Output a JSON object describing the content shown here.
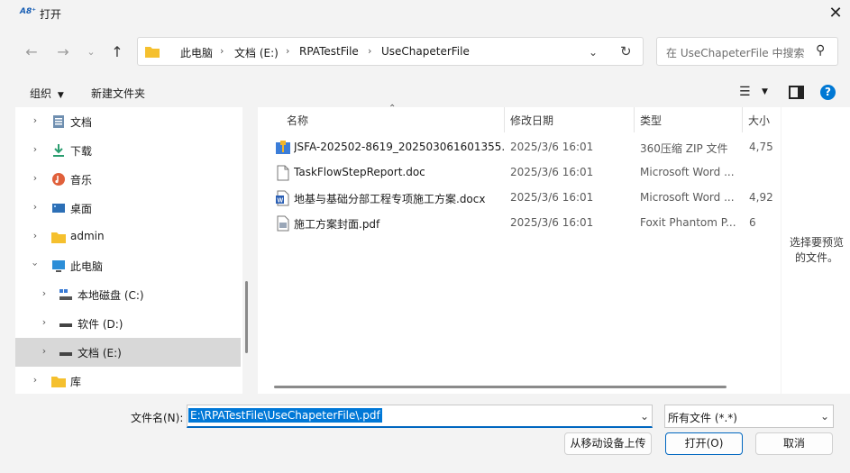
{
  "window": {
    "title": "打开",
    "app_icon": "A8⁺"
  },
  "nav": {
    "breadcrumb": [
      "此电脑",
      "文档 (E:)",
      "RPATestFile",
      "UseChapeterFile"
    ],
    "search_placeholder": "在 UseChapeterFile 中搜索"
  },
  "toolbar": {
    "organize": "组织",
    "new_folder": "新建文件夹"
  },
  "tree": [
    {
      "label": "文档",
      "icon": "documents-icon",
      "indent": 0,
      "selected": false
    },
    {
      "label": "下载",
      "icon": "download-icon",
      "indent": 0,
      "selected": false
    },
    {
      "label": "音乐",
      "icon": "music-icon",
      "indent": 0,
      "selected": false
    },
    {
      "label": "桌面",
      "icon": "desktop-icon",
      "indent": 0,
      "selected": false
    },
    {
      "label": "admin",
      "icon": "folder-icon",
      "indent": 0,
      "selected": false
    },
    {
      "label": "此电脑",
      "icon": "computer-icon",
      "indent": 0,
      "selected": false,
      "expanded": true
    },
    {
      "label": "本地磁盘 (C:)",
      "icon": "drive-os-icon",
      "indent": 1,
      "selected": false
    },
    {
      "label": "软件 (D:)",
      "icon": "drive-icon",
      "indent": 1,
      "selected": false
    },
    {
      "label": "文档 (E:)",
      "icon": "drive-icon",
      "indent": 1,
      "selected": true
    },
    {
      "label": "库",
      "icon": "folder-icon",
      "indent": 0,
      "selected": false
    }
  ],
  "columns": {
    "name": "名称",
    "date": "修改日期",
    "type": "类型",
    "size": "大小"
  },
  "files": [
    {
      "name": "JSFA-202502-8619_202503061601355...",
      "date": "2025/3/6 16:01",
      "type": "360压缩 ZIP 文件",
      "size": "4,75",
      "icon": "zip-icon"
    },
    {
      "name": "TaskFlowStepReport.doc",
      "date": "2025/3/6 16:01",
      "type": "Microsoft Word ...",
      "size": "",
      "icon": "doc-icon"
    },
    {
      "name": "地基与基础分部工程专项施工方案.docx",
      "date": "2025/3/6 16:01",
      "type": "Microsoft Word ...",
      "size": "4,92",
      "icon": "word-icon"
    },
    {
      "name": "施工方案封面.pdf",
      "date": "2025/3/6 16:01",
      "type": "Foxit Phantom P...",
      "size": "6",
      "icon": "pdf-icon"
    }
  ],
  "preview_text": "选择要预览的文件。",
  "bottom": {
    "filename_label": "文件名(N):",
    "filename_value": "E:\\RPATestFile\\UseChapeterFile\\.pdf",
    "filter": "所有文件 (*.*)",
    "upload_button": "从移动设备上传",
    "open_button": "打开(O)",
    "cancel_button": "取消"
  }
}
